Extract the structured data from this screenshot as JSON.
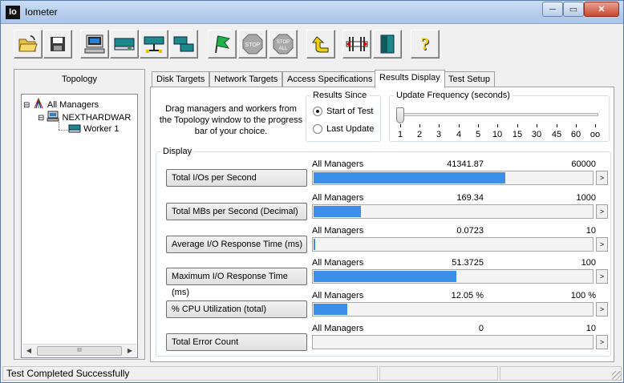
{
  "window": {
    "title": "Iometer",
    "icon_text": "Io",
    "close_label": "✕",
    "maximize_label": "▭",
    "minimize_label": "─"
  },
  "toolbar": {
    "buttons": [
      "open-icon",
      "save-icon",
      "new-manager-icon",
      "new-disk-worker-icon",
      "new-network-worker-icon",
      "copy-worker-icon",
      "start-tests-icon",
      "stop-icon",
      "stop-all-icon",
      "reset-workers-icon",
      "disconnect-icon",
      "exit-icon",
      "about-icon"
    ],
    "stop_label": "STOP",
    "stop_all_label": "STOP",
    "stop_all_sub": "ALL",
    "help_label": "?"
  },
  "topology": {
    "title": "Topology",
    "items": [
      "All Managers",
      "NEXTHARDWAR",
      "Worker 1"
    ],
    "expanders": [
      "⊟",
      "⊟"
    ],
    "scroll_left": "◀",
    "scroll_right": "▶",
    "scroll_grip": "III"
  },
  "tabs": [
    "Disk Targets",
    "Network Targets",
    "Access Specifications",
    "Results Display",
    "Test Setup"
  ],
  "tab_scroll_glyph": "",
  "hint": "Drag managers and workers from the Topology window to the progress bar of your choice.",
  "results_since": {
    "title": "Results Since",
    "options": [
      "Start of Test",
      "Last Update"
    ],
    "selected": "Start of Test"
  },
  "update_frequency": {
    "title": "Update Frequency (seconds)",
    "ticks": [
      "1",
      "2",
      "3",
      "4",
      "5",
      "10",
      "15",
      "30",
      "45",
      "60",
      "oo"
    ],
    "selected": "1"
  },
  "display": {
    "title": "Display",
    "arrow": ">",
    "metrics": [
      {
        "label": "Total I/Os per Second",
        "manager": "All Managers",
        "value": "41341.87",
        "max": "60000",
        "fill": 0.689
      },
      {
        "label": "Total MBs per Second (Decimal)",
        "manager": "All Managers",
        "value": "169.34",
        "max": "1000",
        "fill": 0.169
      },
      {
        "label": "Average I/O Response Time (ms)",
        "manager": "All Managers",
        "value": "0.0723",
        "max": "10",
        "fill": 0.007
      },
      {
        "label": "Maximum I/O Response Time (ms)",
        "manager": "All Managers",
        "value": "51.3725",
        "max": "100",
        "fill": 0.514
      },
      {
        "label": "% CPU Utilization (total)",
        "manager": "All Managers",
        "value": "12.05 %",
        "max": "100 %",
        "fill": 0.1205
      },
      {
        "label": "Total Error Count",
        "manager": "All Managers",
        "value": "0",
        "max": "10",
        "fill": 0
      }
    ]
  },
  "status": {
    "text": "Test Completed Successfully"
  },
  "colors": {
    "bar": "#3b8fe9",
    "titlebar": "#b8cfee"
  }
}
